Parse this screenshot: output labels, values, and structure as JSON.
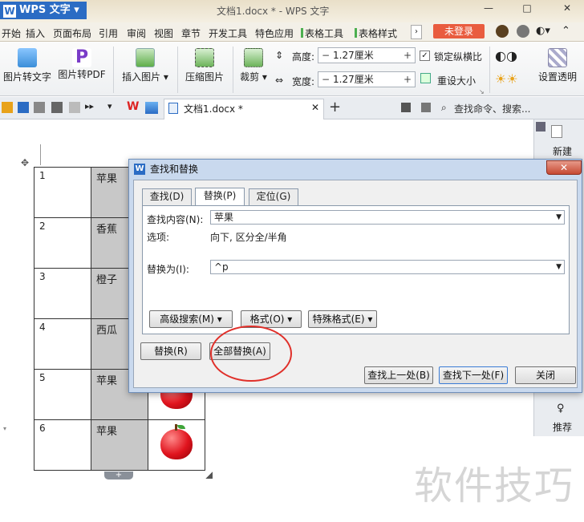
{
  "titlebar": {
    "app_name": "WPS 文字",
    "doc_title": "文档1.docx * - WPS 文字",
    "min": "—",
    "max": "□",
    "close": "✕"
  },
  "menus": [
    "开始",
    "插入",
    "页面布局",
    "引用",
    "审阅",
    "视图",
    "章节",
    "开发工具",
    "特色应用",
    "表格工具",
    "表格样式"
  ],
  "login": "未登录",
  "ribbon": {
    "img_to_text": "图片转文字",
    "img_to_pdf": "图片转PDF",
    "insert_image": "插入图片",
    "compress_image": "压缩图片",
    "crop": "裁剪",
    "height_label": "高度:",
    "height_value": "1.27厘米",
    "width_label": "宽度:",
    "width_value": "1.27厘米",
    "lock_ratio": "锁定纵横比",
    "reset_size": "重设大小",
    "set_transparent": "设置透明"
  },
  "doctab": {
    "name": "文档1.docx *",
    "add": "+",
    "search_placeholder": "查找命令、搜索..."
  },
  "rpanel": {
    "new_label": "新建",
    "recommend_label": "推荐"
  },
  "table_rows": [
    {
      "num": "1",
      "fruit": "苹果"
    },
    {
      "num": "2",
      "fruit": "香蕉"
    },
    {
      "num": "3",
      "fruit": "橙子"
    },
    {
      "num": "4",
      "fruit": "西瓜"
    },
    {
      "num": "5",
      "fruit": "苹果"
    },
    {
      "num": "6",
      "fruit": "苹果"
    }
  ],
  "dialog": {
    "title": "查找和替换",
    "tabs": [
      "查找(D)",
      "替换(P)",
      "定位(G)"
    ],
    "find_label": "查找内容(N):",
    "find_value": "苹果",
    "options_label": "选项:",
    "options_value": "向下, 区分全/半角",
    "replace_label": "替换为(I):",
    "replace_value": "^p",
    "advanced": "高级搜索(M)",
    "format": "格式(O)",
    "special": "特殊格式(E)",
    "replace_btn": "替换(R)",
    "replace_all_btn": "全部替换(A)",
    "find_prev": "查找上一处(B)",
    "find_next": "查找下一处(F)",
    "close_btn": "关闭"
  },
  "watermark": "软件技巧",
  "colors": {
    "accent": "#2b6cc4",
    "login": "#e95c3f",
    "annotation": "#e0302a"
  }
}
